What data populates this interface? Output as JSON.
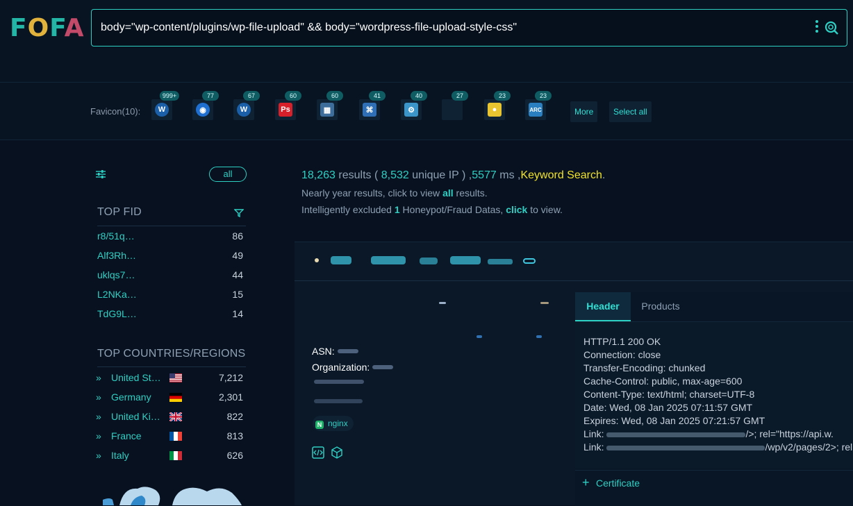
{
  "logo": {
    "text_f": "F",
    "text_o": "O",
    "text_f2": "F",
    "text_a": "A"
  },
  "search": {
    "query": "body=\"wp-content/plugins/wp-file-upload\" && body=\"wordpress-file-upload-style-css\""
  },
  "favicons": {
    "label": "Favicon(10):",
    "items": [
      {
        "badge": "999+",
        "icon": "wordpress-icon",
        "color": "#1b5fa8"
      },
      {
        "badge": "77",
        "icon": "blue-circle-icon",
        "color": "#1f6fd1"
      },
      {
        "badge": "67",
        "icon": "wordpress-icon",
        "color": "#1b5fa8"
      },
      {
        "badge": "60",
        "icon": "ps-icon",
        "color": "#d8202a"
      },
      {
        "badge": "60",
        "icon": "grid-icon",
        "color": "#3d6d9a"
      },
      {
        "badge": "41",
        "icon": "python-icon",
        "color": "#2f6fb5"
      },
      {
        "badge": "40",
        "icon": "gears-icon",
        "color": "#3b95c9"
      },
      {
        "badge": "27",
        "icon": "blank-icon",
        "color": "#0f2233"
      },
      {
        "badge": "23",
        "icon": "emblem-icon",
        "color": "#e8c431"
      },
      {
        "badge": "23",
        "icon": "arc-icon",
        "color": "#2a7fc0"
      }
    ],
    "more_label": "More",
    "select_all_label": "Select all"
  },
  "sidebar": {
    "all_label": "all",
    "top_fid_title": "TOP FID",
    "fid": [
      {
        "key": "r8/51q…",
        "count": "86"
      },
      {
        "key": "Alf3Rh…",
        "count": "49"
      },
      {
        "key": "uklqs7…",
        "count": "44"
      },
      {
        "key": "L2NKa…",
        "count": "15"
      },
      {
        "key": "TdG9L…",
        "count": "14"
      }
    ],
    "top_countries_title": "TOP COUNTRIES/REGIONS",
    "countries": [
      {
        "name": "United St…",
        "count": "7,212",
        "flag": "us"
      },
      {
        "name": "Germany",
        "count": "2,301",
        "flag": "de"
      },
      {
        "name": "United Ki…",
        "count": "822",
        "flag": "gb"
      },
      {
        "name": "France",
        "count": "813",
        "flag": "fr"
      },
      {
        "name": "Italy",
        "count": "626",
        "flag": "it"
      }
    ]
  },
  "results": {
    "count": "18,263",
    "results_word": " results ( ",
    "unique_ip": "8,532",
    "unique_ip_word": " unique IP ) ,",
    "time": "5577",
    "time_unit": " ms ,",
    "mode": "Keyword Search",
    "dot": ".",
    "line2_a": "Nearly year results, click to view ",
    "line2_link": "all",
    "line2_b": " results.",
    "line3_a": "Intelligently excluded ",
    "line3_num": "1",
    "line3_b": " Honeypot/Fraud Datas, ",
    "line3_link": "click",
    "line3_c": " to view."
  },
  "card": {
    "asn_label": "ASN:",
    "org_label": "Organization:",
    "server_tag": "nginx",
    "tabs": {
      "header": "Header",
      "products": "Products"
    },
    "header_lines": [
      "HTTP/1.1 200 OK",
      "Connection: close",
      "Transfer-Encoding: chunked",
      "Cache-Control: public, max-age=600",
      "Content-Type: text/html; charset=UTF-8",
      "Date: Wed, 08 Jan 2025 07:11:57 GMT",
      "Expires: Wed, 08 Jan 2025 07:21:57 GMT",
      "Link: ",
      "Link: "
    ],
    "link1_tail": "/>; rel=\"https://api.w.",
    "link2_tail": "/wp/v2/pages/2>; rel",
    "certificate_label": "Certificate"
  }
}
